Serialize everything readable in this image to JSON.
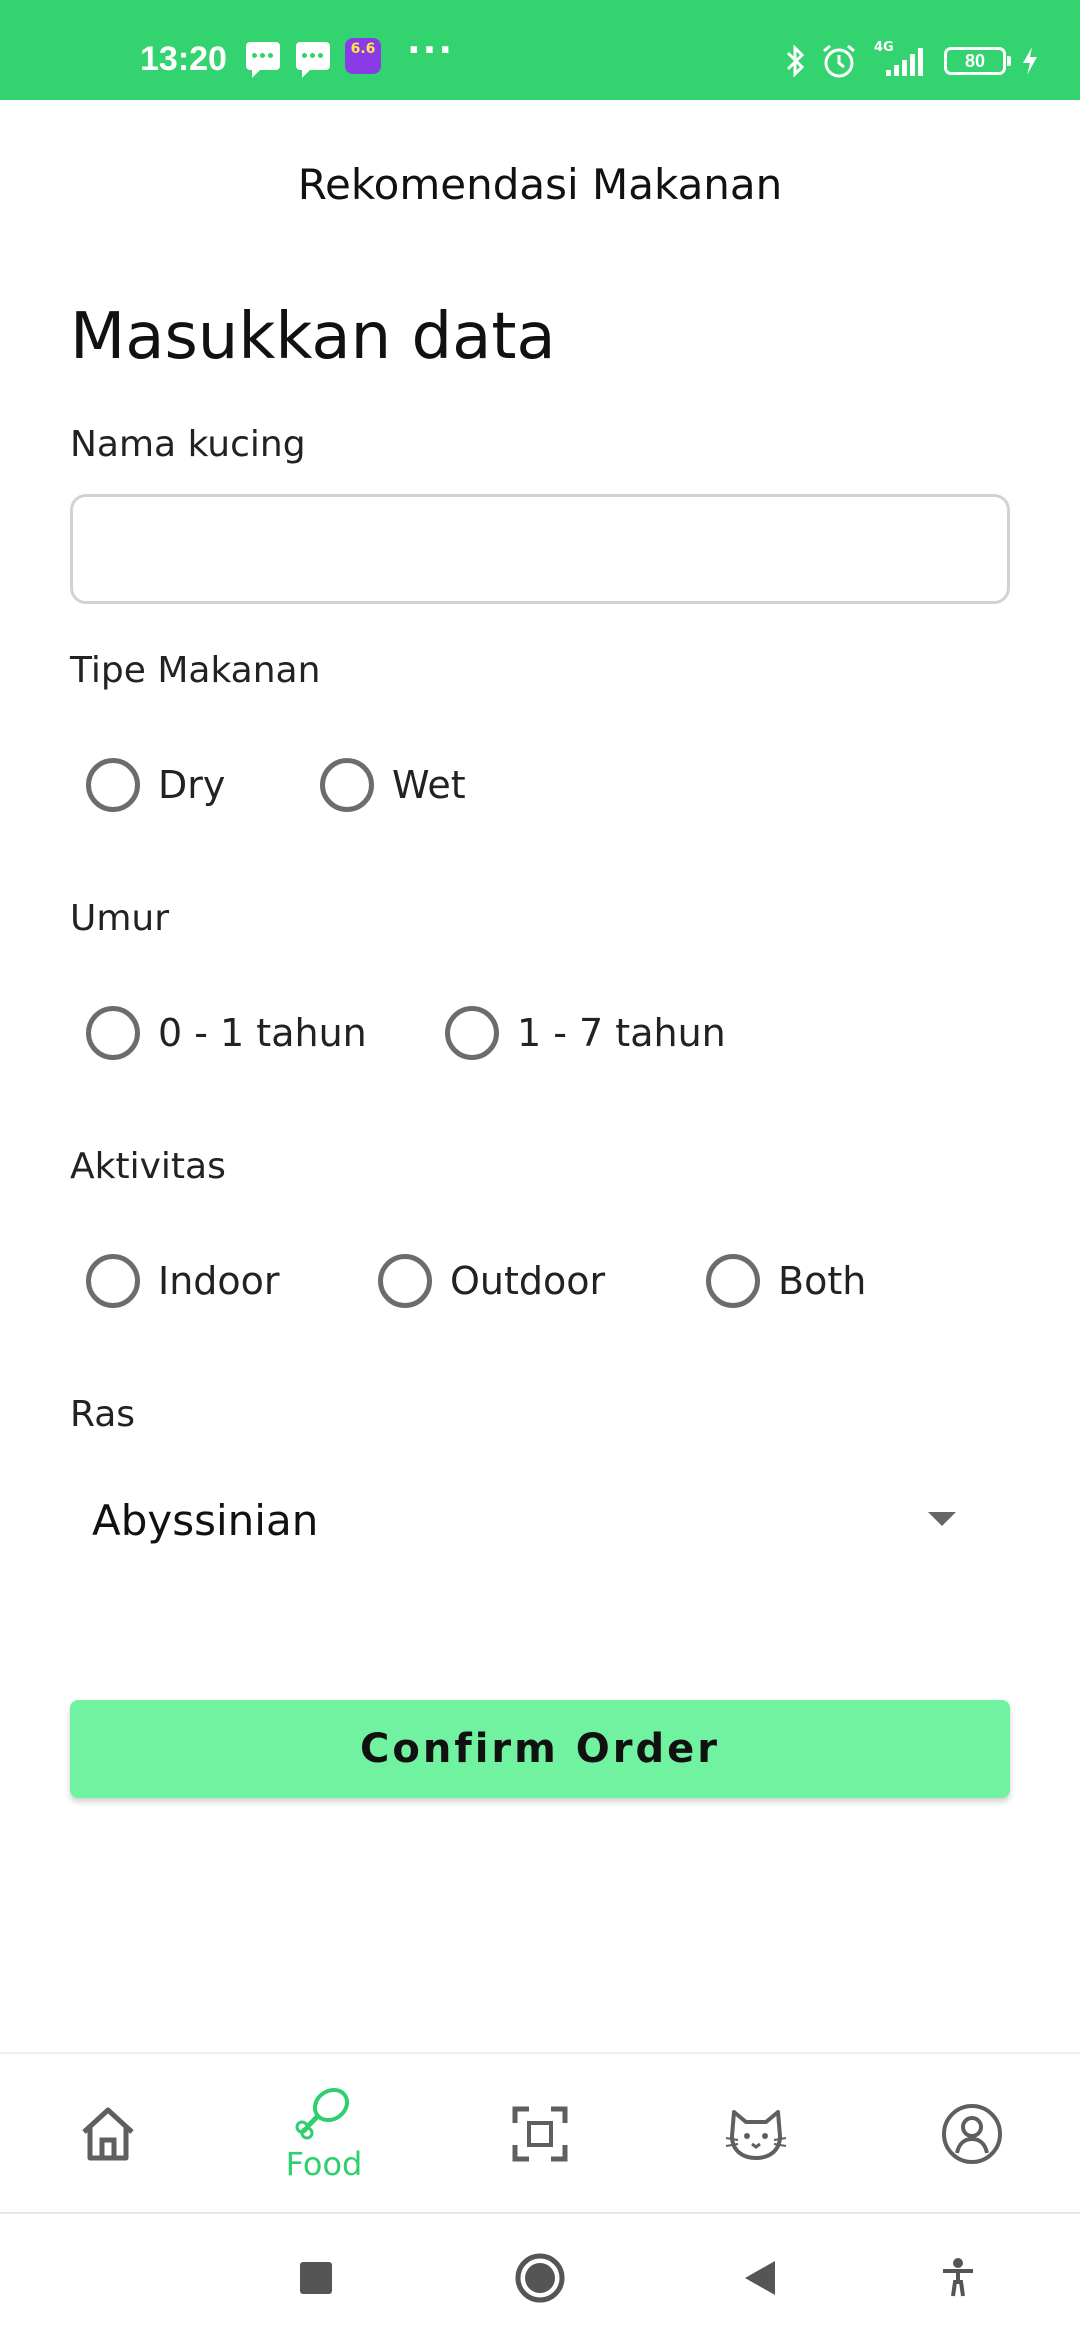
{
  "status_bar": {
    "time": "13:20",
    "promo_badge": "6.6",
    "battery_level": "80",
    "network": "4G",
    "icons": [
      "message-icon",
      "message-icon",
      "promo-app-icon",
      "more-dots-icon",
      "bluetooth-icon",
      "alarm-icon",
      "signal-icon",
      "battery-icon",
      "charging-icon"
    ]
  },
  "header": {
    "title": "Rekomendasi Makanan"
  },
  "form": {
    "heading": "Masukkan data",
    "name_label": "Nama kucing",
    "name_value": "",
    "food_type_label": "Tipe Makanan",
    "food_type_options": [
      "Dry",
      "Wet"
    ],
    "age_label": "Umur",
    "age_options": [
      "0 - 1 tahun",
      "1 - 7 tahun"
    ],
    "activity_label": "Aktivitas",
    "activity_options": [
      "Indoor",
      "Outdoor",
      "Both"
    ],
    "breed_label": "Ras",
    "breed_selected": "Abyssinian",
    "confirm_label": "Confirm Order"
  },
  "bottom_nav": {
    "items": [
      {
        "icon": "home-icon",
        "label": ""
      },
      {
        "icon": "drumstick-icon",
        "label": "Food"
      },
      {
        "icon": "scan-icon",
        "label": ""
      },
      {
        "icon": "cat-icon",
        "label": ""
      },
      {
        "icon": "profile-icon",
        "label": ""
      }
    ],
    "active_color": "#2ecf6e",
    "inactive_color": "#5f5f5f"
  },
  "colors": {
    "status_bar": "#33d36f",
    "button": "#70f2a0",
    "accent": "#2ecf6e"
  }
}
